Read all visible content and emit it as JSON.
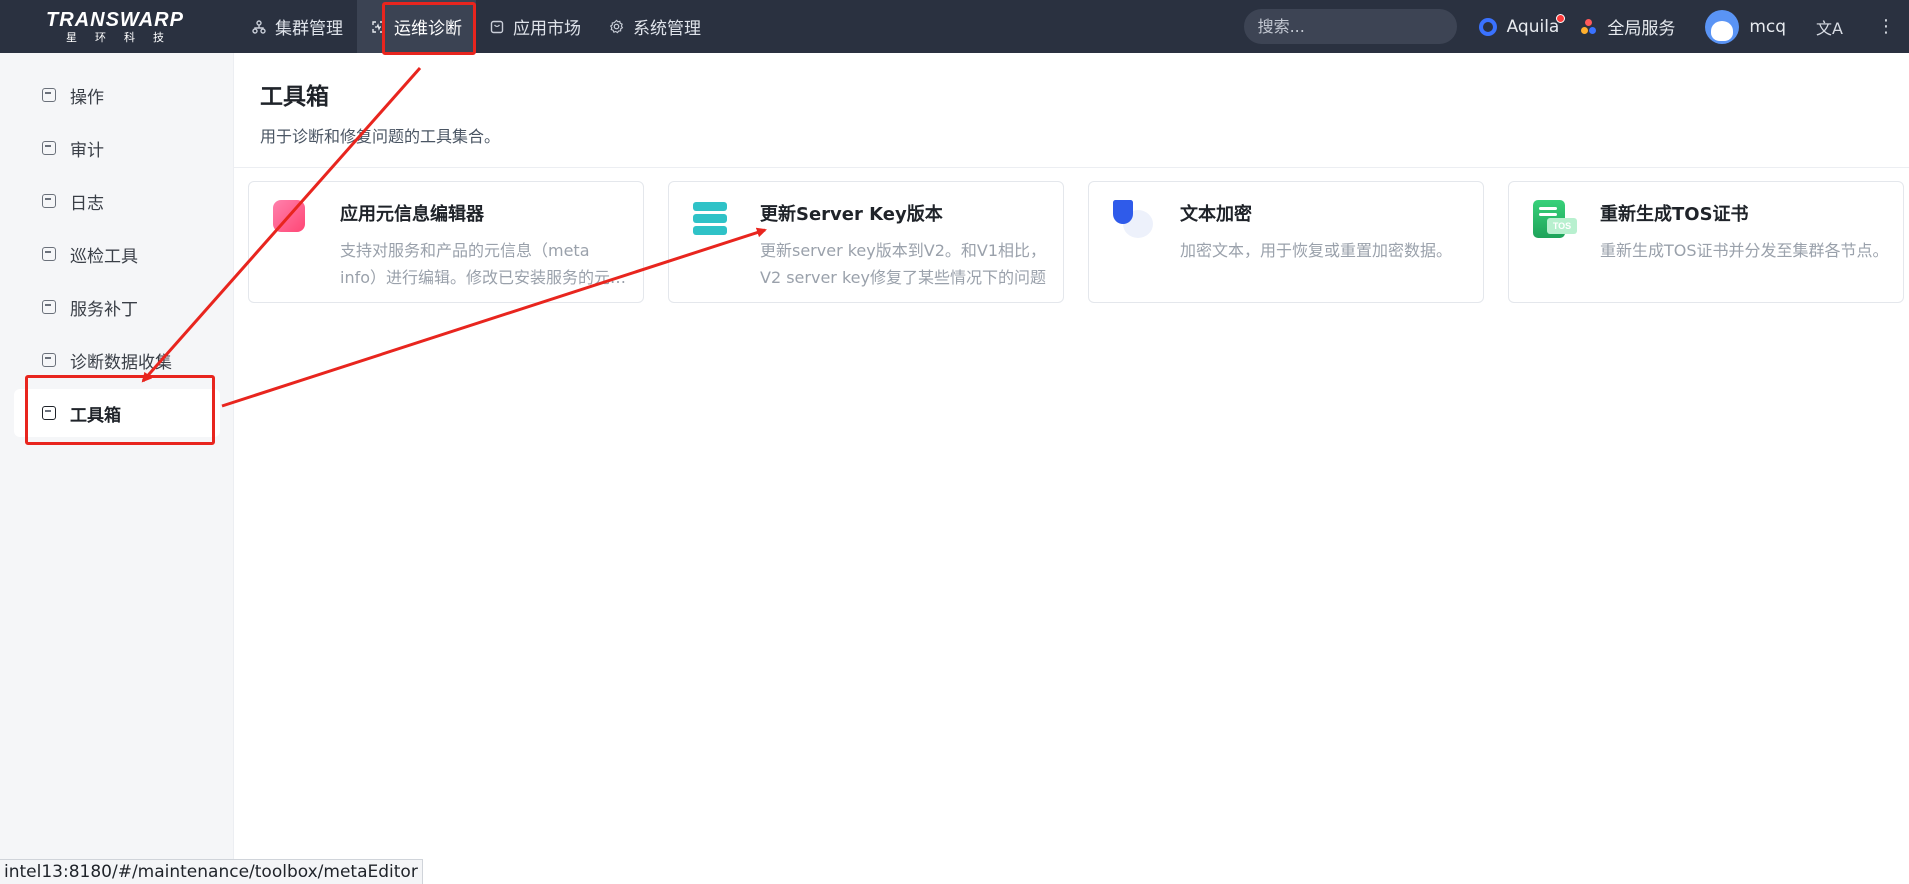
{
  "header": {
    "logo_main": "TRANSWARP",
    "logo_sub": "星环科技",
    "nav": [
      {
        "label": "集群管理",
        "icon": "cluster-icon"
      },
      {
        "label": "运维诊断",
        "icon": "maintenance-icon"
      },
      {
        "label": "应用市场",
        "icon": "market-icon"
      },
      {
        "label": "系统管理",
        "icon": "gear-icon"
      }
    ],
    "search_placeholder": "搜索...",
    "aquila_label": "Aquila",
    "global_service_label": "全局服务",
    "username": "mcq",
    "lang_icon": "文A",
    "more_icon": "⋮"
  },
  "sidebar": {
    "items": [
      {
        "label": "操作"
      },
      {
        "label": "审计"
      },
      {
        "label": "日志"
      },
      {
        "label": "巡检工具"
      },
      {
        "label": "服务补丁"
      },
      {
        "label": "诊断数据收集"
      },
      {
        "label": "工具箱"
      }
    ],
    "active_index": 6
  },
  "main": {
    "title": "工具箱",
    "description": "用于诊断和修复问题的工具集合。",
    "cards": [
      {
        "title": "应用元信息编辑器",
        "desc": "支持对服务和产品的元信息（meta info）进行编辑。修改已安装服务的元信息可能会导致服务异常",
        "icon": "meta-editor-icon"
      },
      {
        "title": "更新Server Key版本",
        "desc": "更新server key版本到V2。和V1相比，V2 server key修复了某些情况下的问题",
        "icon": "server-key-icon"
      },
      {
        "title": "文本加密",
        "desc": "加密文本，用于恢复或重置加密数据。",
        "icon": "shield-icon"
      },
      {
        "title": "重新生成TOS证书",
        "desc": "重新生成TOS证书并分发至集群各节点。",
        "icon": "tos-cert-icon"
      }
    ],
    "tos_tag": "TOS"
  },
  "status_bar": {
    "url": "intel13:8180/#/maintenance/toolbox/metaEditor"
  },
  "colors": {
    "topbar": "#2a3140",
    "annotation_red": "#e8251e",
    "accent_blue": "#3a72ff"
  }
}
